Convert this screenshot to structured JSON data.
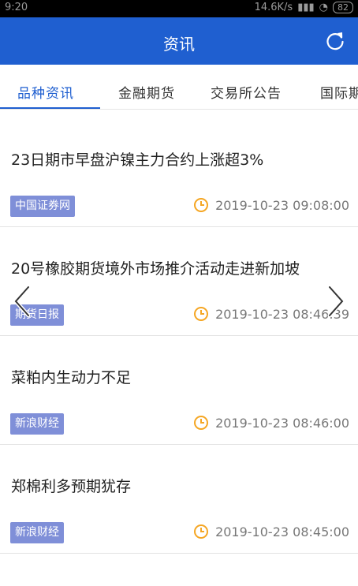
{
  "status": {
    "time": "9:20",
    "network_speed": "14.6K/s",
    "battery": "82"
  },
  "appbar": {
    "title": "资讯",
    "refresh_icon": "refresh-icon"
  },
  "tabs": [
    {
      "label": "品种资讯",
      "active": true
    },
    {
      "label": "金融期货",
      "active": false
    },
    {
      "label": "交易所公告",
      "active": false
    },
    {
      "label": "国际期",
      "active": false
    }
  ],
  "news": [
    {
      "headline": "23日期市早盘沪镍主力合约上涨超3%",
      "source": "中国证券网",
      "time": "2019-10-23 09:08:00"
    },
    {
      "headline": "20号橡胶期货境外市场推介活动走进新加坡",
      "source": "期货日报",
      "time": "2019-10-23 08:46:39"
    },
    {
      "headline": "菜粕内生动力不足",
      "source": "新浪财经",
      "time": "2019-10-23 08:46:00"
    },
    {
      "headline": "郑棉利多预期犹存",
      "source": "新浪财经",
      "time": "2019-10-23 08:45:00"
    }
  ],
  "colors": {
    "primary": "#1f5fd0",
    "source_badge": "#7f8fd8",
    "clock": "#f5a623"
  }
}
